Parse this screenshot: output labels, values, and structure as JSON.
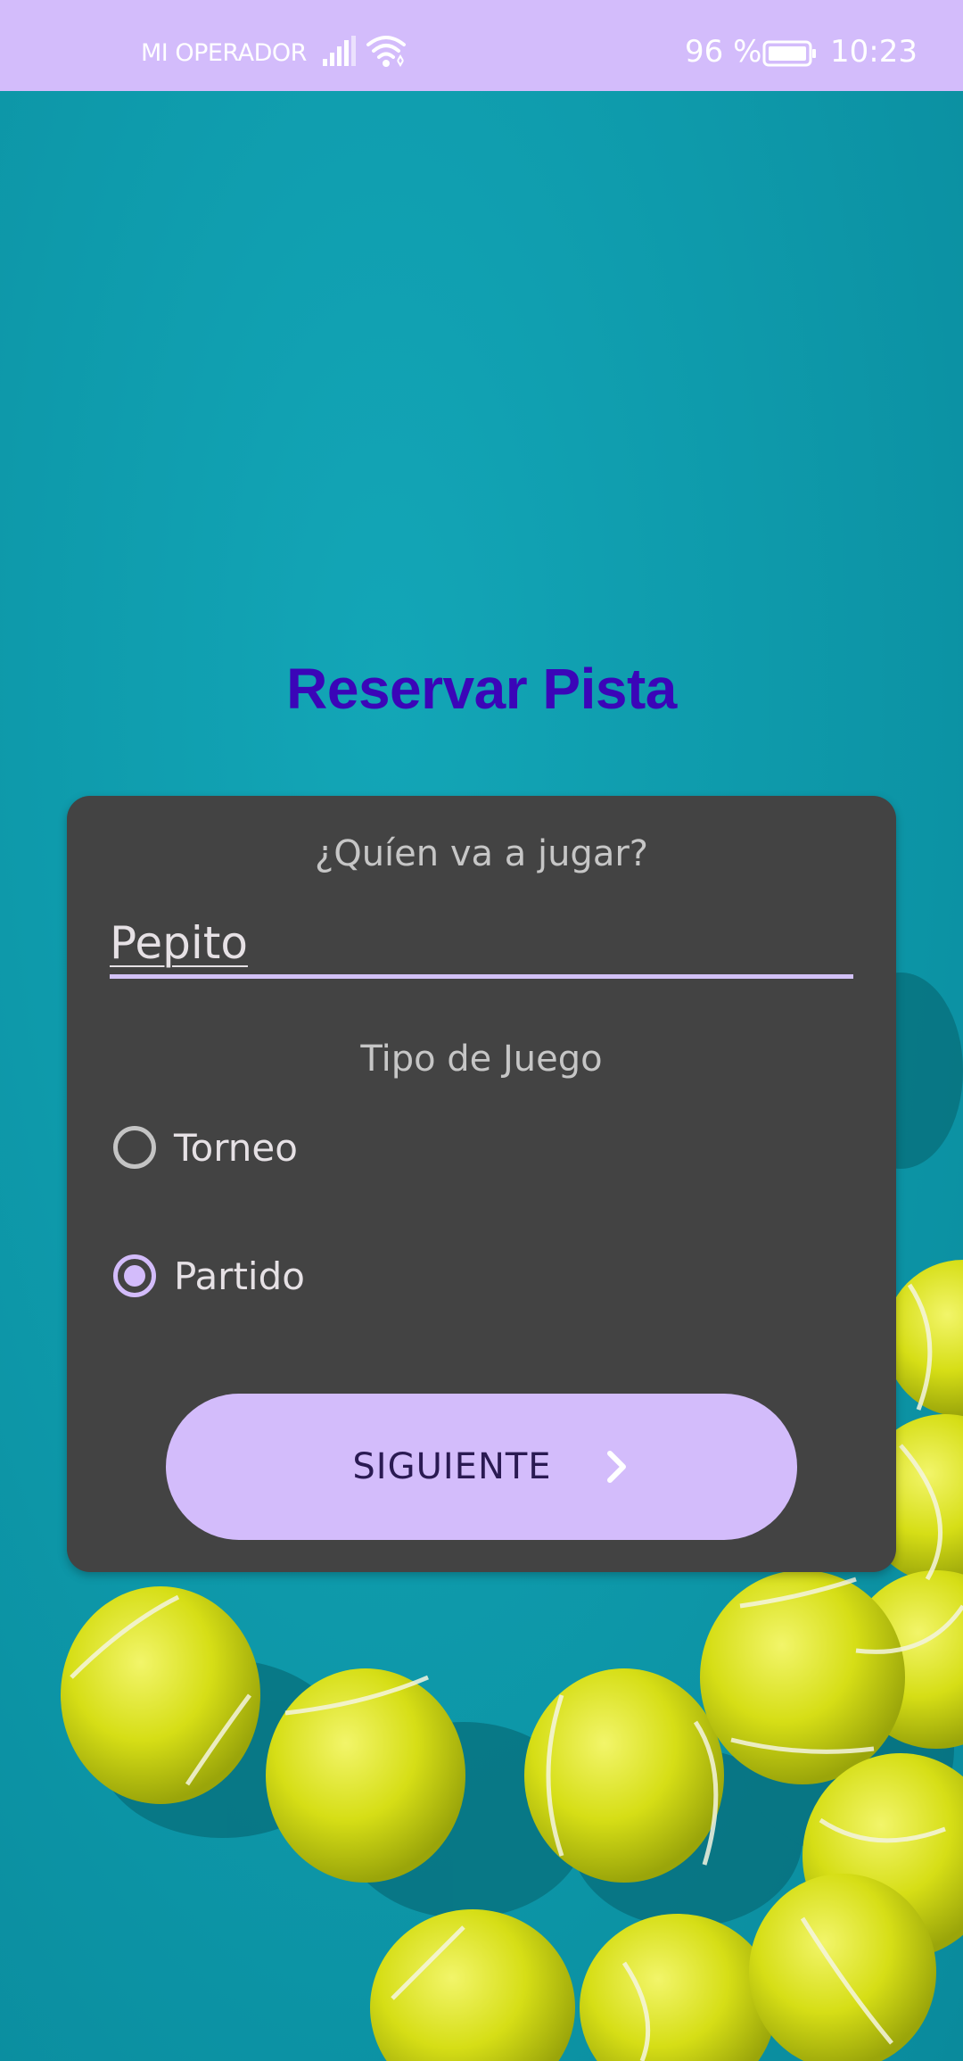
{
  "status_bar": {
    "carrier": "MI OPERADOR",
    "battery_percent": "96 %",
    "time": "10:23",
    "icons": [
      "signal-icon",
      "wifi-icon",
      "battery-icon"
    ]
  },
  "screen": {
    "title": "Reservar Pista"
  },
  "form": {
    "question": "¿Quíen va a jugar?",
    "player_name": "Pepito",
    "game_type_label": "Tipo de Juego",
    "options": [
      {
        "label": "Torneo",
        "selected": false
      },
      {
        "label": "Partido",
        "selected": true
      }
    ],
    "next_button": {
      "label": "SIGUIENTE",
      "icon": "chevron-right-icon"
    }
  },
  "colors": {
    "status_bar": "#d3bcfb",
    "title": "#3b05b8",
    "card": "#434343",
    "accent": "#d3bcfb",
    "button_text": "#2a1a52"
  }
}
